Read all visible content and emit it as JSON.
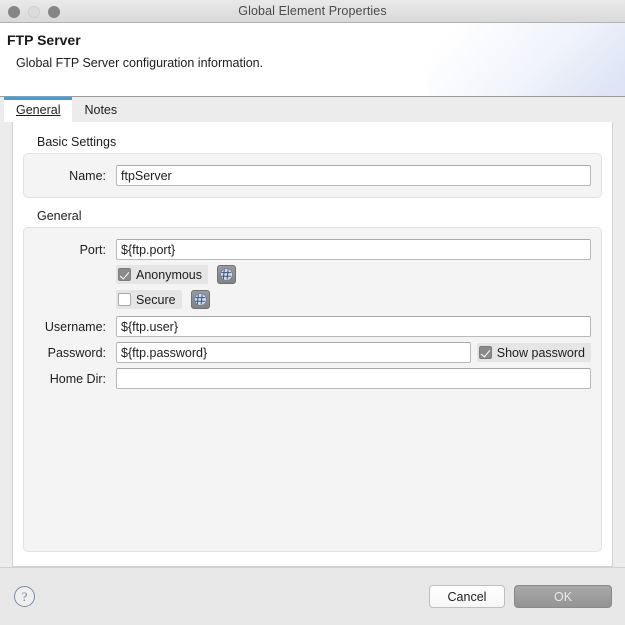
{
  "window": {
    "title": "Global Element Properties",
    "traffic_lights": [
      "close-light",
      "minimize-light",
      "zoom-light"
    ]
  },
  "header": {
    "title": "FTP Server",
    "description": "Global FTP Server configuration information."
  },
  "tabs": [
    {
      "label": "General",
      "selected": true
    },
    {
      "label": "Notes",
      "selected": false
    }
  ],
  "groups": {
    "basic_settings": {
      "title": "Basic Settings",
      "fields": [
        {
          "label": "Name:",
          "value": "ftpServer",
          "placeholder": ""
        }
      ]
    },
    "general": {
      "title": "General",
      "port": {
        "label": "Port:",
        "value": "${ftp.port}",
        "placeholder": ""
      },
      "anonymous": {
        "label": "Anonymous",
        "checked": true,
        "expression_button": "expression-icon"
      },
      "secure": {
        "label": "Secure",
        "checked": false,
        "expression_button": "expression-icon"
      },
      "username": {
        "label": "Username:",
        "value": "${ftp.user}",
        "placeholder": ""
      },
      "password": {
        "label": "Password:",
        "value": "${ftp.password}",
        "placeholder": ""
      },
      "show_password": {
        "label": "Show password",
        "checked": true
      },
      "home_dir": {
        "label": "Home Dir:",
        "value": "",
        "placeholder": ""
      }
    }
  },
  "footer": {
    "help": "?",
    "cancel_label": "Cancel",
    "ok_label": "OK"
  },
  "colors": {
    "accent_tab": "#4a9ad4",
    "titlebar": "#e1e1e1",
    "panel_bg": "#ffffff",
    "group_bg": "#f4f4f4",
    "footer_bg": "#e8e8e8",
    "ok_button": "#9c9c9c",
    "help_outline": "#7b8ba8"
  }
}
